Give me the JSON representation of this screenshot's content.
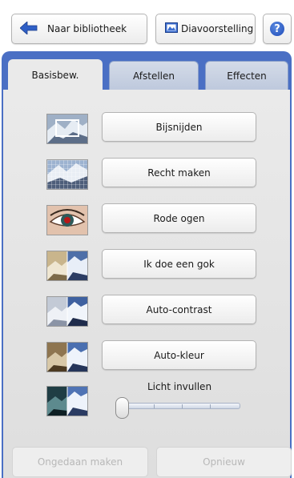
{
  "toolbar": {
    "library_label": "Naar bibliotheek",
    "slideshow_label": "Diavoorstelling",
    "help_label": "?"
  },
  "tabs": [
    {
      "label": "Basisbew.",
      "active": true
    },
    {
      "label": "Afstellen",
      "active": false
    },
    {
      "label": "Effecten",
      "active": false
    }
  ],
  "actions": [
    {
      "label": "Bijsnijden",
      "icon": "crop-thumbnail"
    },
    {
      "label": "Recht maken",
      "icon": "straighten-thumbnail"
    },
    {
      "label": "Rode ogen",
      "icon": "red-eye-thumbnail"
    },
    {
      "label": "Ik doe een gok",
      "icon": "auto-fix-thumbnail"
    },
    {
      "label": "Auto-contrast",
      "icon": "auto-contrast-thumbnail"
    },
    {
      "label": "Auto-kleur",
      "icon": "auto-color-thumbnail"
    }
  ],
  "fill_light": {
    "label": "Licht invullen",
    "icon": "fill-light-thumbnail",
    "value": 0
  },
  "footer": {
    "undo_label": "Ongedaan maken",
    "redo_label": "Opnieuw"
  },
  "colors": {
    "panel_accent": "#4a6fc4",
    "help_icon": "#1d49b8",
    "back_arrow": "#2f5fc6"
  }
}
